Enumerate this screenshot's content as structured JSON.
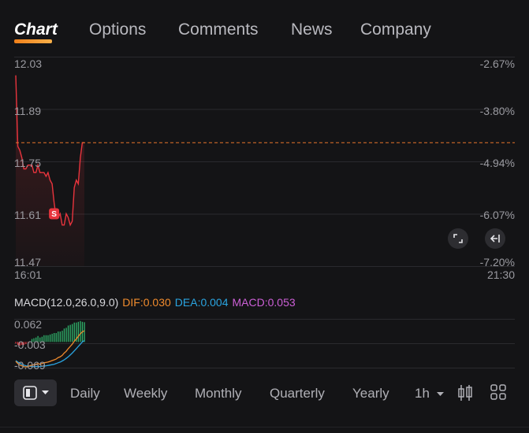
{
  "tabs": [
    {
      "label": "Chart",
      "active": true
    },
    {
      "label": "Options"
    },
    {
      "label": "Comments"
    },
    {
      "label": "News"
    },
    {
      "label": "Company"
    }
  ],
  "price_axis": [
    "12.03",
    "11.89",
    "11.75",
    "11.61",
    "11.47"
  ],
  "pct_axis": [
    "-2.67%",
    "-3.80%",
    "-4.94%",
    "-6.07%",
    "-7.20%"
  ],
  "time_axis": {
    "start": "16:01",
    "end": "21:30"
  },
  "marker_label": "S",
  "macd": {
    "title": "MACD(12.0,26.0,9.0)",
    "dif": "DIF:0.030",
    "dea": "DEA:0.004",
    "macd": "MACD:0.053",
    "axis": [
      "0.062",
      "-0.003",
      "-0.069"
    ]
  },
  "periods": [
    "Daily",
    "Weekly",
    "Monthly",
    "Quarterly",
    "Yearly",
    "1h"
  ],
  "colors": {
    "price_line": "#e8343d",
    "reference_line": "#e8752a",
    "dif": "#f08b2d",
    "dea": "#2aa4e0",
    "macd": "#cc5fd6",
    "up_bar": "#2fb36b",
    "down_bar": "#e8343d",
    "accent": "#f0801a"
  },
  "icons": {
    "fullscreen": "expand-icon",
    "back": "arrow-left-bar-icon",
    "layout": "split-layout-icon",
    "candle": "candlestick-icon",
    "grid": "grid-icon"
  },
  "chart_data": [
    {
      "type": "line",
      "x_range": [
        "16:01",
        "21:30"
      ],
      "ylim": [
        11.47,
        12.03
      ],
      "reference_price": 11.8,
      "series": [
        {
          "values": [
            11.98,
            11.79,
            11.78,
            11.76,
            11.73,
            11.73,
            11.74,
            11.74,
            11.74,
            11.72,
            11.72,
            11.74,
            11.72,
            11.72,
            11.72,
            11.71,
            11.72,
            11.7,
            11.69,
            11.64,
            11.6,
            11.6,
            11.61,
            11.58,
            11.58,
            11.61,
            11.6,
            11.58,
            11.59,
            11.68,
            11.7,
            11.69,
            11.76,
            11.8,
            11.8
          ]
        }
      ],
      "annotation": {
        "label": "S",
        "price": 11.61
      }
    },
    {
      "type": "line",
      "ylim": [
        -0.069,
        0.062
      ],
      "series": [
        {
          "name": "DIF",
          "values": [
            -0.052,
            -0.058,
            -0.062,
            -0.064,
            -0.066,
            -0.067,
            -0.066,
            -0.064,
            -0.062,
            -0.061,
            -0.06,
            -0.058,
            -0.06,
            -0.058,
            -0.056,
            -0.055,
            -0.054,
            -0.052,
            -0.05,
            -0.048,
            -0.046,
            -0.042,
            -0.04,
            -0.036,
            -0.03,
            -0.025,
            -0.018,
            -0.012,
            -0.006,
            0.002,
            0.008,
            0.015,
            0.022,
            0.027,
            0.03
          ]
        },
        {
          "name": "DEA",
          "values": [
            -0.05,
            -0.054,
            -0.057,
            -0.06,
            -0.062,
            -0.064,
            -0.065,
            -0.065,
            -0.066,
            -0.066,
            -0.066,
            -0.066,
            -0.066,
            -0.065,
            -0.065,
            -0.064,
            -0.063,
            -0.062,
            -0.061,
            -0.06,
            -0.058,
            -0.056,
            -0.054,
            -0.051,
            -0.048,
            -0.044,
            -0.04,
            -0.035,
            -0.03,
            -0.024,
            -0.018,
            -0.012,
            -0.006,
            0.0,
            0.004
          ]
        },
        {
          "name": "MACD",
          "values": [
            -0.004,
            -0.008,
            -0.01,
            -0.008,
            -0.008,
            -0.006,
            -0.002,
            0.002,
            0.008,
            0.01,
            0.012,
            0.016,
            0.012,
            0.014,
            0.018,
            0.018,
            0.018,
            0.02,
            0.022,
            0.024,
            0.024,
            0.028,
            0.028,
            0.03,
            0.036,
            0.038,
            0.044,
            0.046,
            0.048,
            0.052,
            0.052,
            0.054,
            0.056,
            0.054,
            0.053
          ]
        }
      ]
    }
  ]
}
